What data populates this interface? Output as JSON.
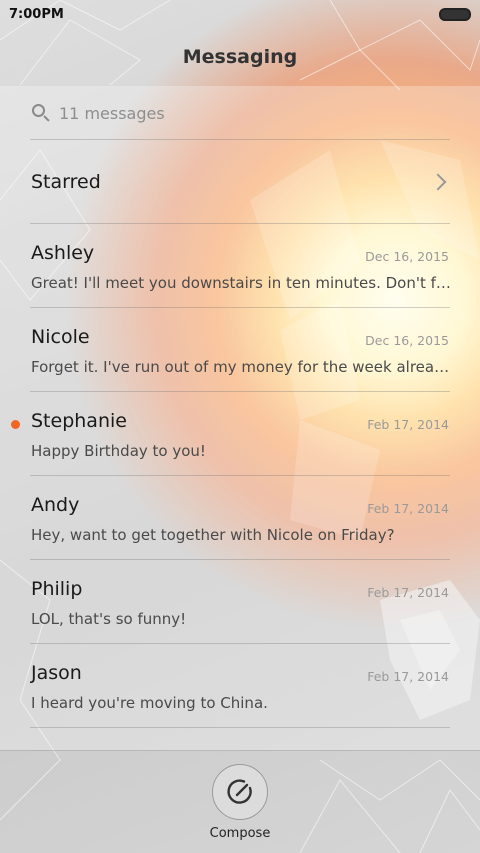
{
  "status_bar": {
    "time": "7:00PM"
  },
  "header": {
    "title": "Messaging"
  },
  "search": {
    "placeholder": "11 messages"
  },
  "starred": {
    "label": "Starred"
  },
  "conversations": [
    {
      "name": "Ashley",
      "date": "Dec 16, 2015",
      "preview": "Great! I'll meet you downstairs in ten minutes. Don't forget the camera.",
      "unread": false
    },
    {
      "name": "Nicole",
      "date": "Dec 16, 2015",
      "preview": "Forget it. I've run out of my money for the week already.",
      "unread": false
    },
    {
      "name": "Stephanie",
      "date": "Feb 17, 2014",
      "preview": "Happy Birthday to you!",
      "unread": true
    },
    {
      "name": "Andy",
      "date": "Feb 17, 2014",
      "preview": "Hey, want to get together with Nicole on Friday?",
      "unread": false
    },
    {
      "name": "Philip",
      "date": "Feb 17, 2014",
      "preview": "LOL, that's so funny!",
      "unread": false
    },
    {
      "name": "Jason",
      "date": "Feb 17, 2014",
      "preview": "I heard you're moving to China.",
      "unread": false
    }
  ],
  "compose": {
    "label": "Compose",
    "icon": "compose-icon"
  },
  "colors": {
    "unread_dot": "#f26522",
    "date": "#9a9a9a",
    "title": "#333333"
  }
}
